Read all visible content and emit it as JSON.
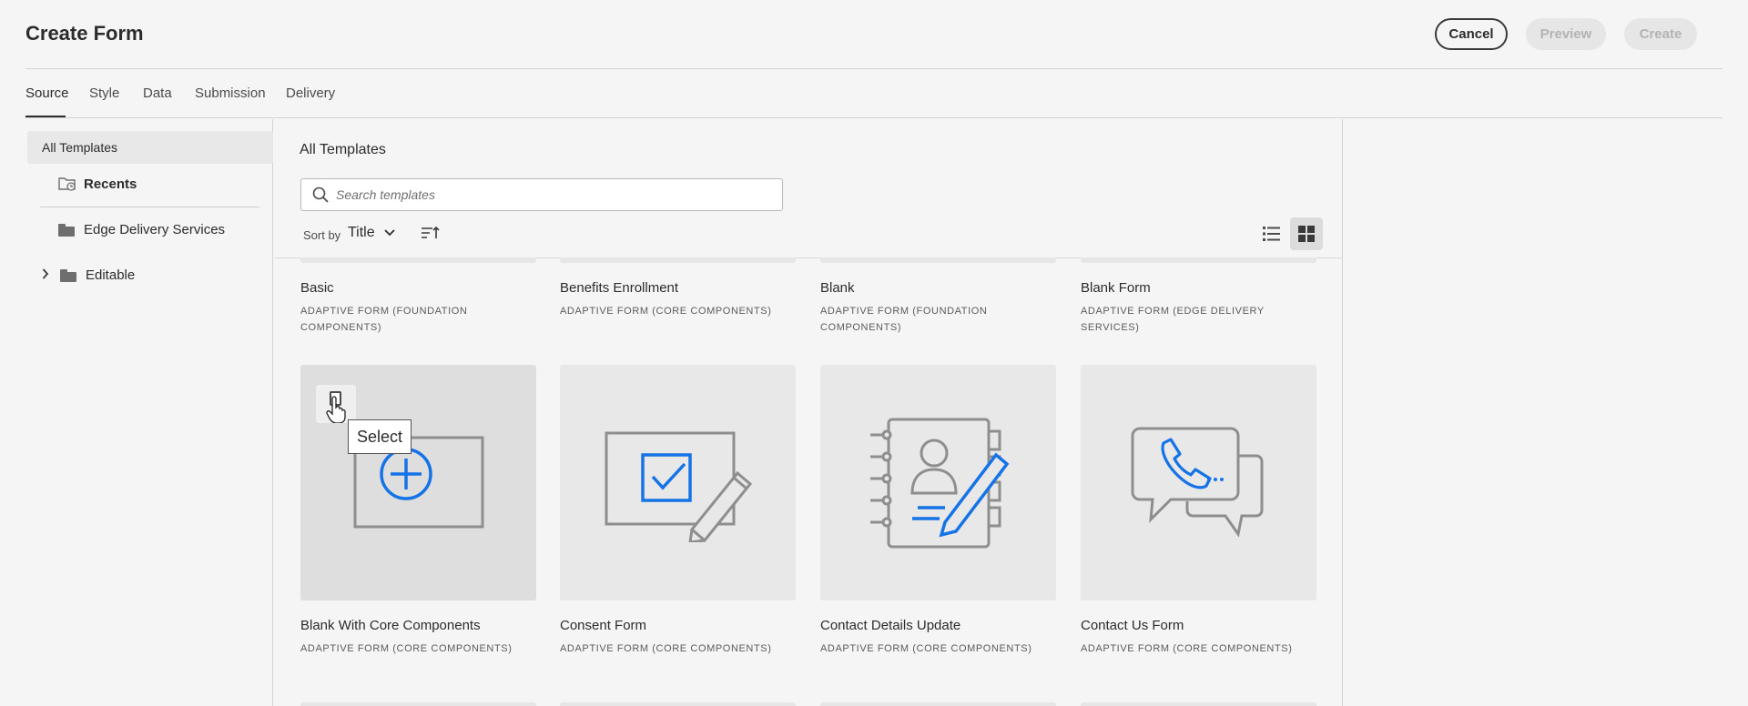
{
  "header": {
    "title": "Create Form",
    "cancel_label": "Cancel",
    "preview_label": "Preview",
    "create_label": "Create"
  },
  "tabs": [
    {
      "label": "Source",
      "active": true
    },
    {
      "label": "Style"
    },
    {
      "label": "Data"
    },
    {
      "label": "Submission"
    },
    {
      "label": "Delivery"
    }
  ],
  "sidebar": {
    "all_templates": "All Templates",
    "items": [
      {
        "label": "Recents",
        "icon": "recents-folder-icon"
      },
      {
        "label": "Edge Delivery Services",
        "icon": "folder-icon"
      },
      {
        "label": "Editable",
        "icon": "folder-icon",
        "expandable": true
      }
    ]
  },
  "main": {
    "title": "All Templates",
    "search_placeholder": "Search templates",
    "sort_by_label": "Sort by",
    "sort_value": "Title"
  },
  "templates_row1": [
    {
      "title": "Basic",
      "subtitle": "ADAPTIVE FORM (FOUNDATION COMPONENTS)"
    },
    {
      "title": "Benefits Enrollment",
      "subtitle": "ADAPTIVE FORM (CORE COMPONENTS)"
    },
    {
      "title": "Blank",
      "subtitle": "ADAPTIVE FORM (FOUNDATION COMPONENTS)"
    },
    {
      "title": "Blank Form",
      "subtitle": "ADAPTIVE FORM (EDGE DELIVERY SERVICES)"
    }
  ],
  "templates_row2": [
    {
      "title": "Blank With Core Components",
      "subtitle": "ADAPTIVE FORM (CORE COMPONENTS)",
      "icon": "add-form-icon"
    },
    {
      "title": "Consent Form",
      "subtitle": "ADAPTIVE FORM (CORE COMPONENTS)",
      "icon": "consent-form-icon"
    },
    {
      "title": "Contact Details Update",
      "subtitle": "ADAPTIVE FORM (CORE COMPONENTS)",
      "icon": "contact-book-icon"
    },
    {
      "title": "Contact Us Form",
      "subtitle": "ADAPTIVE FORM (CORE COMPONENTS)",
      "icon": "chat-phone-icon"
    }
  ],
  "tooltip": "Select",
  "colors": {
    "accent_blue": "#1473e6",
    "icon_gray": "#8e8e8e"
  }
}
